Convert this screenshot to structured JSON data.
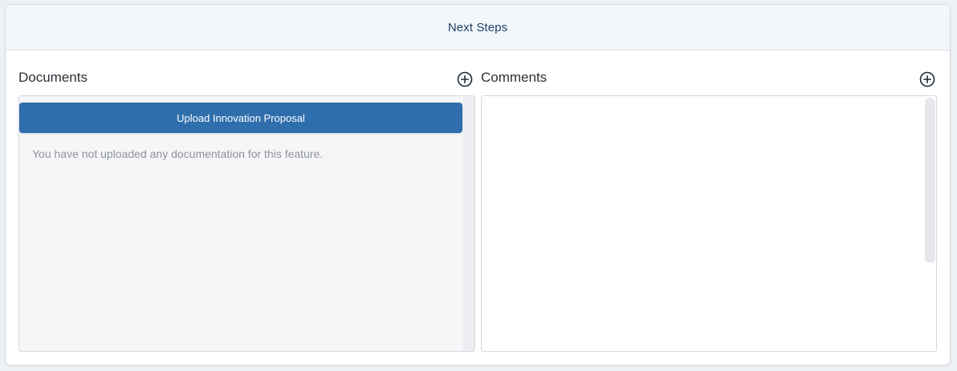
{
  "header": {
    "title": "Next Steps"
  },
  "documents": {
    "title": "Documents",
    "add_icon": "plus-circle-icon",
    "upload_button_label": "Upload Innovation Proposal",
    "empty_message": "You have not uploaded any documentation for this feature."
  },
  "comments": {
    "title": "Comments",
    "add_icon": "plus-circle-icon"
  },
  "colors": {
    "primary": "#2f6eac",
    "header_bg": "#f3f7fb",
    "title_text": "#1f3f64",
    "muted_text": "#8d939b"
  }
}
